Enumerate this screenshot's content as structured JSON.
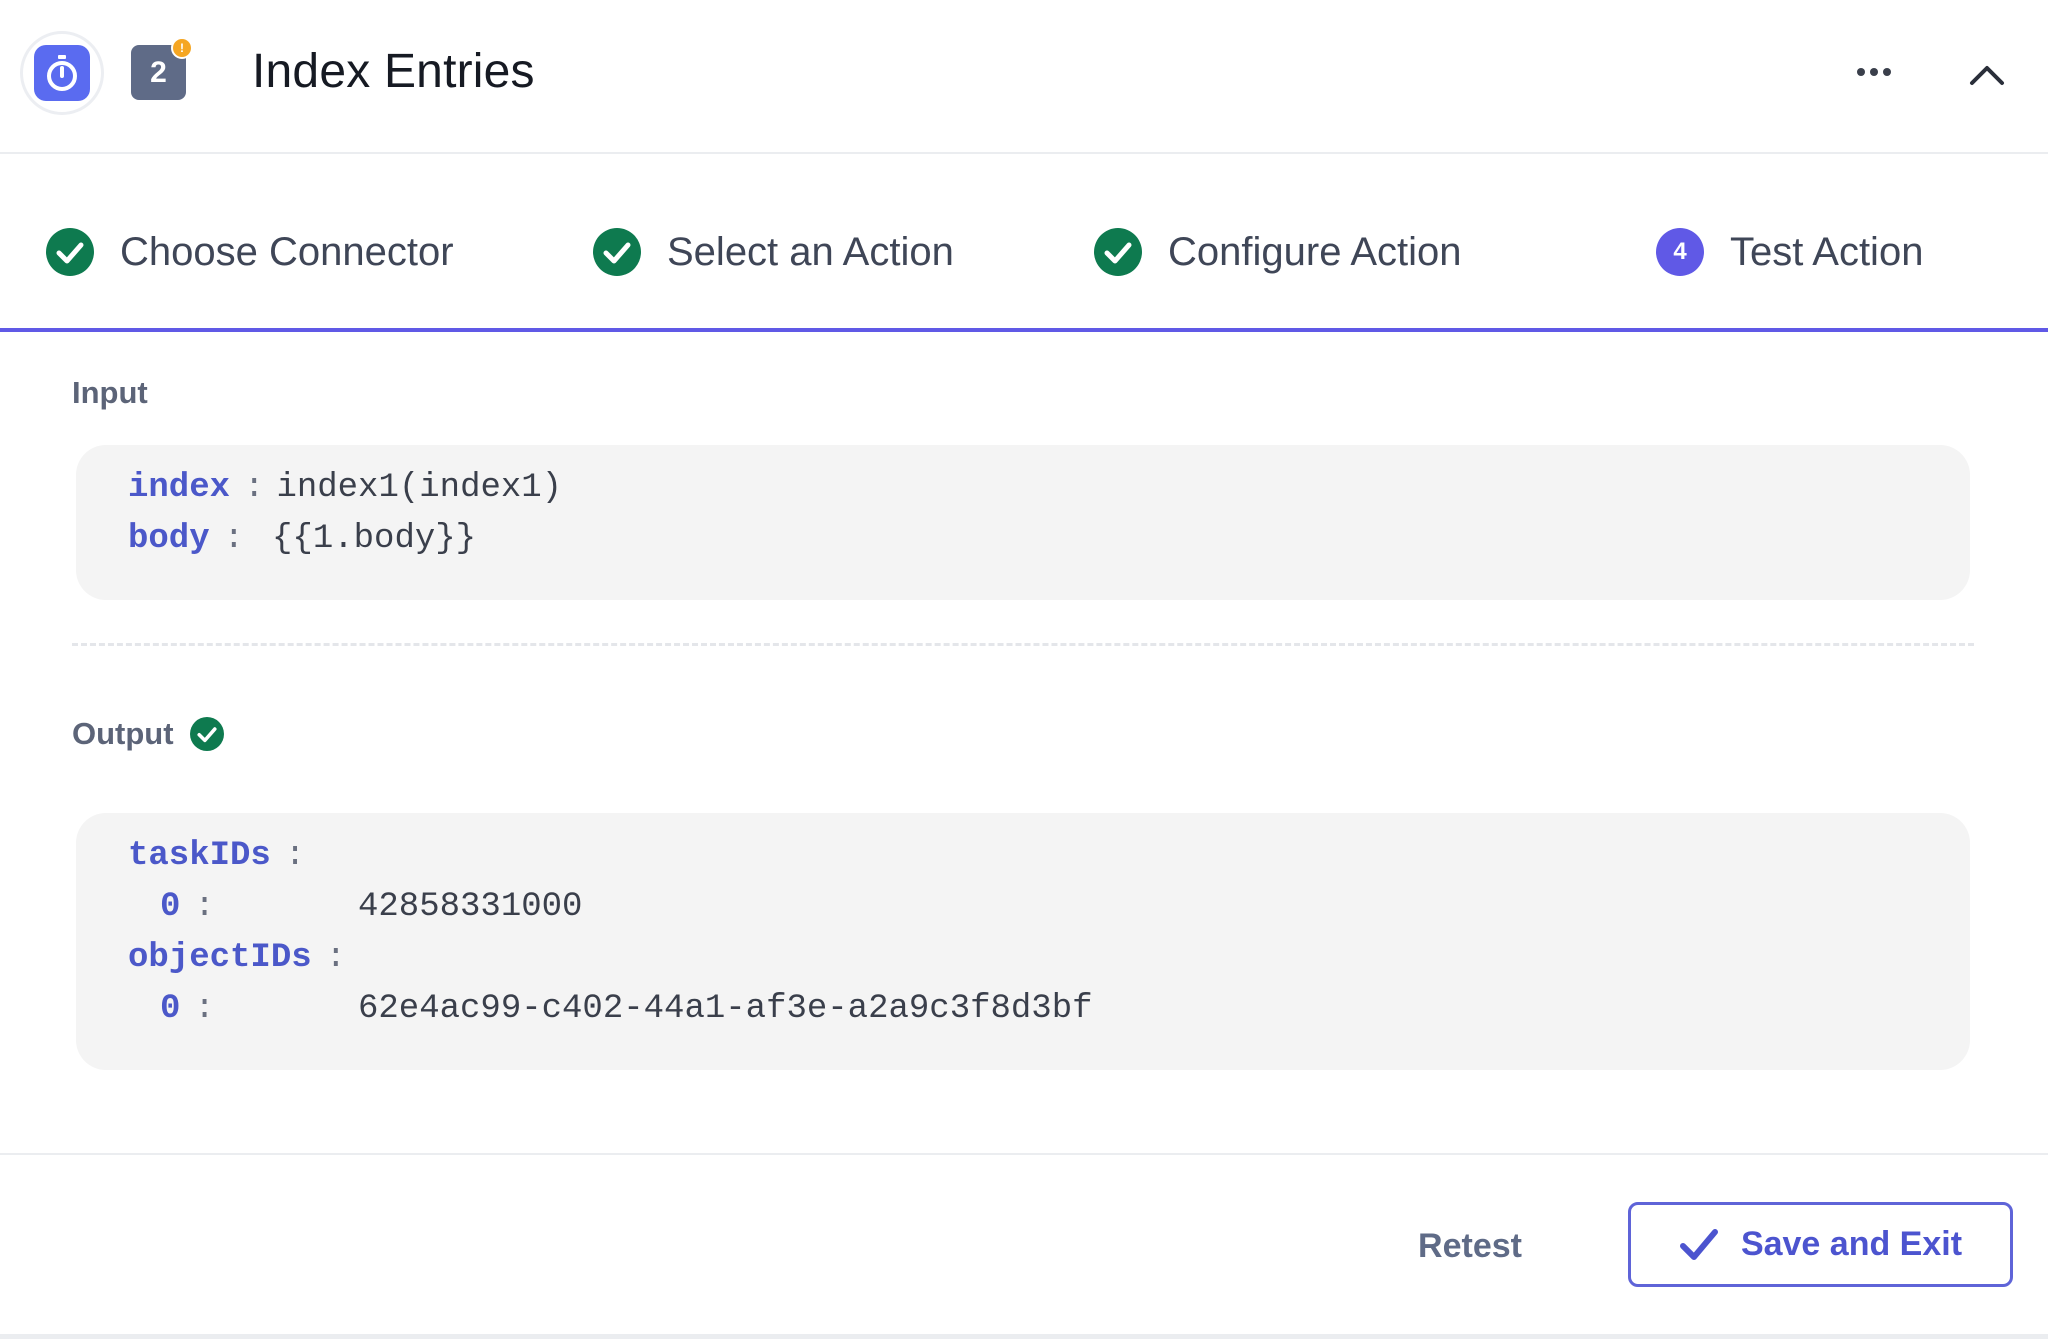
{
  "header": {
    "app_icon": "stopwatch-icon",
    "step_number": "2",
    "step_badge_indicator": "!",
    "title": "Index Entries",
    "more_icon": "more-horizontal-icon",
    "collapse_icon": "chevron-up-icon"
  },
  "stepper": {
    "steps": [
      {
        "label": "Choose Connector",
        "status": "complete"
      },
      {
        "label": "Select an Action",
        "status": "complete"
      },
      {
        "label": "Configure Action",
        "status": "complete"
      },
      {
        "label": "Test Action",
        "status": "active",
        "number": "4"
      }
    ]
  },
  "input": {
    "label": "Input",
    "rows": [
      {
        "key": "index",
        "value": "index1(index1)"
      },
      {
        "key": "body",
        "value": "{{1.body}}"
      }
    ]
  },
  "output": {
    "label": "Output",
    "status": "success",
    "rows": [
      {
        "key": "taskIDs",
        "children": [
          {
            "key": "0",
            "value": "42858331000"
          }
        ]
      },
      {
        "key": "objectIDs",
        "children": [
          {
            "key": "0",
            "value": "62e4ac99-c402-44a1-af3e-a2a9c3f8d3bf"
          }
        ]
      }
    ]
  },
  "footer": {
    "retest_label": "Retest",
    "save_label": "Save and Exit"
  },
  "colors": {
    "accent": "#6059e6",
    "success": "#0e7a4f",
    "key": "#4b58c9",
    "badge": "#5f6b87",
    "warning": "#f5a623"
  }
}
